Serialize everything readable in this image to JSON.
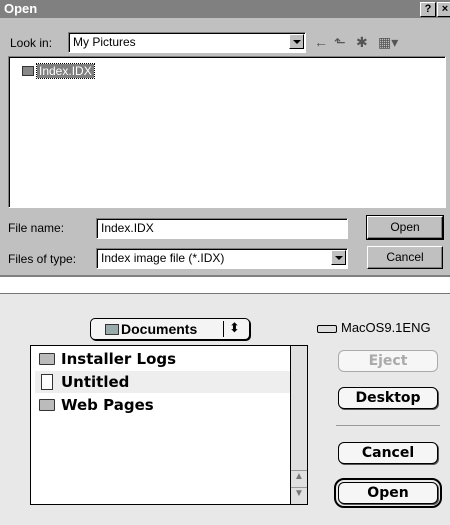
{
  "windows_dialog": {
    "title": "Open",
    "title_buttons": [
      "?",
      "×"
    ],
    "look_in_label": "Look in:",
    "look_in_value": "My Pictures",
    "toolbar_icons": [
      "back-icon",
      "up-folder-icon",
      "new-folder-icon",
      "view-menu-icon"
    ],
    "files": [
      {
        "name": "Index.IDX",
        "selected": true
      }
    ],
    "file_name_label": "File name:",
    "file_name_value": "Index.IDX",
    "files_of_type_label": "Files of type:",
    "files_of_type_value": "Index image file (*.IDX)",
    "open_button": "Open",
    "cancel_button": "Cancel"
  },
  "mac_dialog": {
    "location_popup": "Documents",
    "volume": "MacOS9.1ENG",
    "items": [
      {
        "name": "Installer Logs",
        "type": "folder"
      },
      {
        "name": "Untitled",
        "type": "document"
      },
      {
        "name": "Web Pages",
        "type": "folder"
      }
    ],
    "eject_button": "Eject",
    "desktop_button": "Desktop",
    "cancel_button": "Cancel",
    "open_button": "Open"
  }
}
